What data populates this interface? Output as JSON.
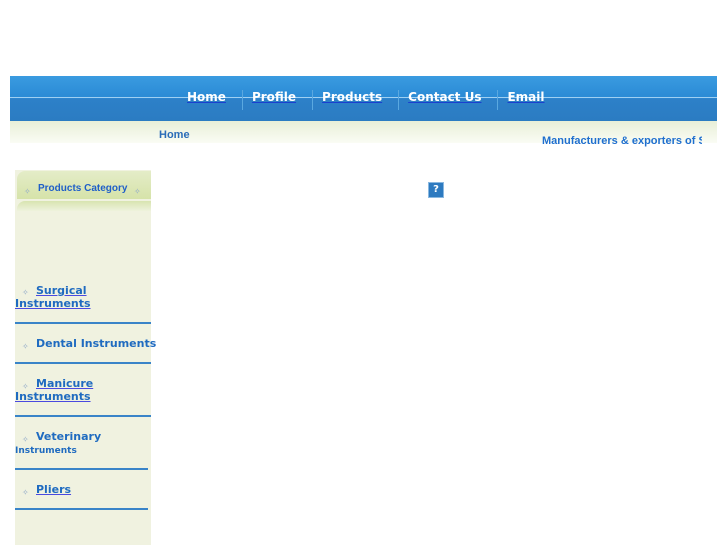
{
  "nav": {
    "items": [
      "Home",
      "Profile",
      "Products",
      "Contact Us",
      "Email"
    ]
  },
  "breadcrumb": "Home",
  "tagline": "Manufacturers & exporters of Surgical",
  "sidebar": {
    "title": "Products Category",
    "items": [
      {
        "line1": "Surgical",
        "line2": "Instruments"
      },
      {
        "line1": "Dental Instruments",
        "line2": ""
      },
      {
        "line1": "Manicure",
        "line2": "Instruments"
      },
      {
        "line1": "Veterinary",
        "line2": "Instruments"
      },
      {
        "line1": "Pliers",
        "line2": ""
      }
    ]
  },
  "help_icon": "?"
}
